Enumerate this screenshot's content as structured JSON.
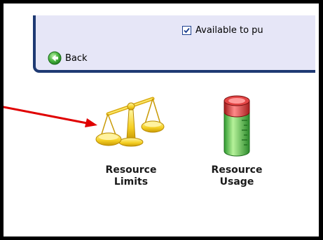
{
  "panel": {
    "available_label": "Available to pu",
    "available_checked": true,
    "back_label": "Back"
  },
  "tiles": [
    {
      "line1": "Resource",
      "line2": "Limits",
      "icon": "scales-icon"
    },
    {
      "line1": "Resource",
      "line2": "Usage",
      "icon": "cylinder-gauge-icon"
    }
  ],
  "colors": {
    "frame": "#000000",
    "panel_bg": "#e6e6f7",
    "panel_border": "#1f3a73",
    "arrow": "#e00000",
    "back_green": "#3aa63a"
  }
}
